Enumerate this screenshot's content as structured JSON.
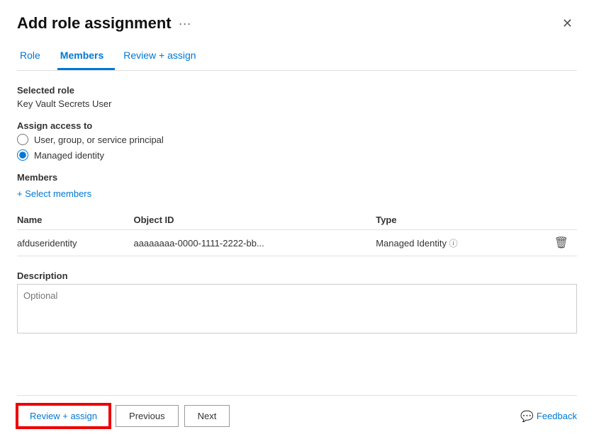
{
  "dialog": {
    "title": "Add role assignment",
    "more_icon": "···",
    "close_icon": "✕"
  },
  "tabs": [
    {
      "id": "role",
      "label": "Role",
      "active": false
    },
    {
      "id": "members",
      "label": "Members",
      "active": true
    },
    {
      "id": "review",
      "label": "Review + assign",
      "active": false
    }
  ],
  "selected_role": {
    "label": "Selected role",
    "value": "Key Vault Secrets User"
  },
  "assign_access": {
    "label": "Assign access to",
    "options": [
      {
        "id": "user-group",
        "label": "User, group, or service principal",
        "checked": false
      },
      {
        "id": "managed-identity",
        "label": "Managed identity",
        "checked": true
      }
    ]
  },
  "members": {
    "label": "Members",
    "select_btn": "+ Select members",
    "table": {
      "headers": [
        "Name",
        "Object ID",
        "Type"
      ],
      "rows": [
        {
          "name": "afduseridentity",
          "object_id": "aaaaaaaa-0000-1111-2222-bb...",
          "type": "Managed Identity"
        }
      ]
    }
  },
  "description": {
    "label": "Description",
    "placeholder": "Optional"
  },
  "footer": {
    "review_btn": "Review + assign",
    "previous_btn": "Previous",
    "next_btn": "Next",
    "feedback_icon": "feedback-icon",
    "feedback_btn": "Feedback"
  }
}
